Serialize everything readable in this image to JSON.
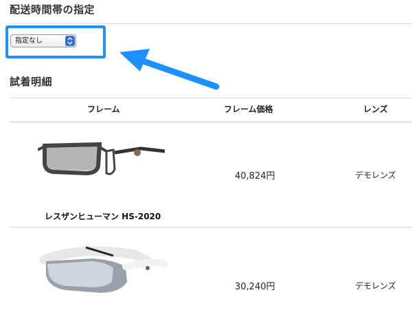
{
  "delivery": {
    "title": "配送時間帯の指定",
    "select_value": "指定なし"
  },
  "detail": {
    "title": "試着明細",
    "columns": [
      "フレーム",
      "フレーム価格",
      "レンズ"
    ],
    "rows": [
      {
        "name": "レスザンヒューマン HS-2020",
        "price": "40,824円",
        "lens": "デモレンズ"
      },
      {
        "name": "",
        "price": "30,240円",
        "lens": "デモレンズ"
      }
    ]
  },
  "colors": {
    "highlight": "#1e90ff",
    "select_arrow": "#2f6fd6"
  },
  "icons": {
    "annotation": "arrow-icon",
    "select": "chevron-updown-icon"
  }
}
